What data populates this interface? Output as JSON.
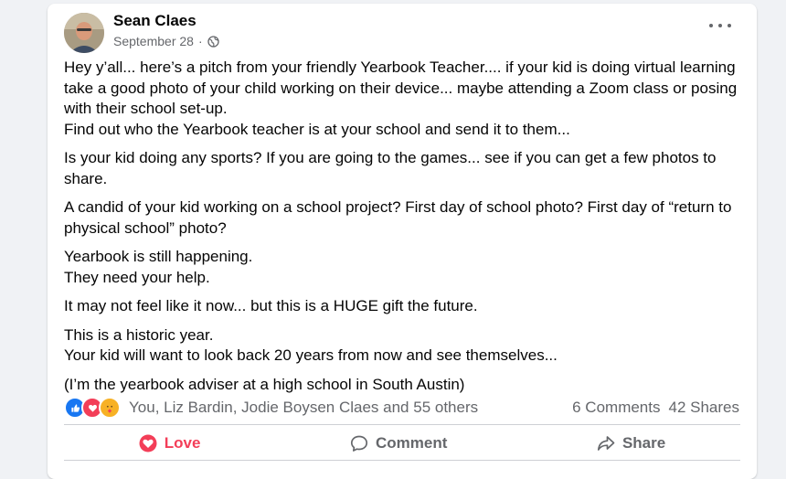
{
  "post": {
    "author": "Sean Claes",
    "date": "September 28",
    "separator": "·",
    "paragraphs": [
      "Hey y’all... here’s a pitch from your friendly Yearbook Teacher.... if your kid is doing virtual learning take a good photo of your child working on their device... maybe attending a Zoom class or posing with their school set-up.\nFind out who the Yearbook teacher is at your school and send it to them...",
      "Is your kid doing any sports? If you are going to the games... see if you can get a few photos to share.",
      "A candid of your kid working on a school project? First day of school photo? First day of “return to physical school” photo?",
      "Yearbook is still happening.\nThey need your help.",
      "It may not feel like it now... but this is a HUGE gift the future.",
      "This is a historic year.\nYour kid will want to look back 20 years from now and see themselves...",
      "(I’m the yearbook adviser at a high school in South Austin)"
    ]
  },
  "stats": {
    "reactors": "You, Liz Bardin, Jodie Boysen Claes and 55 others",
    "comments": "6 Comments",
    "shares": "42 Shares"
  },
  "actions": {
    "love": "Love",
    "comment": "Comment",
    "share": "Share"
  },
  "colors": {
    "love": "#f33e58",
    "like": "#1877f2",
    "care": "#f7b125",
    "secondary_text": "#65676b"
  }
}
